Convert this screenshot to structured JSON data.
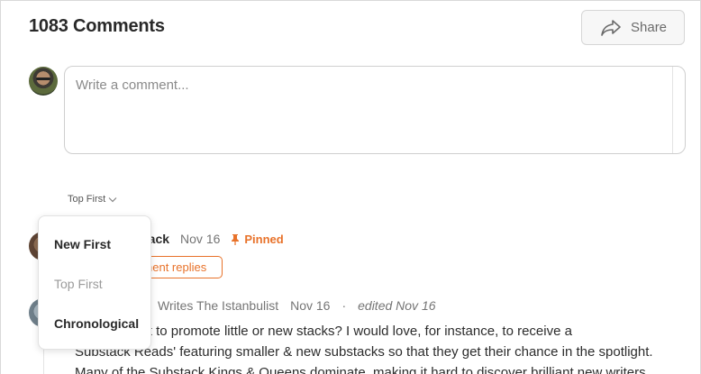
{
  "header": {
    "title": "1083 Comments",
    "share_label": "Share"
  },
  "composer": {
    "placeholder": "Write a comment..."
  },
  "sort": {
    "current": "Top First",
    "options": [
      "New First",
      "Top First",
      "Chronological"
    ]
  },
  "comments": [
    {
      "author_visible": "tack",
      "date": "Nov 16",
      "pinned_label": "Pinned",
      "replies_visible": "nent replies"
    },
    {
      "author_visible": "Writes The Istanbulist",
      "date": "Nov 16",
      "separator": "·",
      "edited": "edited Nov 16",
      "lines": [
        "e plans afoot to promote little or new stacks? I would love, for instance, to receive a",
        "Substack Reads' featuring smaller & new substacks so that they get their chance in the spotlight.",
        "Many of the Substack Kings & Queens dominate, making it hard to discover brilliant new writers"
      ]
    }
  ],
  "colors": {
    "accent": "#e8722a",
    "text": "#292929",
    "muted": "#757575"
  }
}
